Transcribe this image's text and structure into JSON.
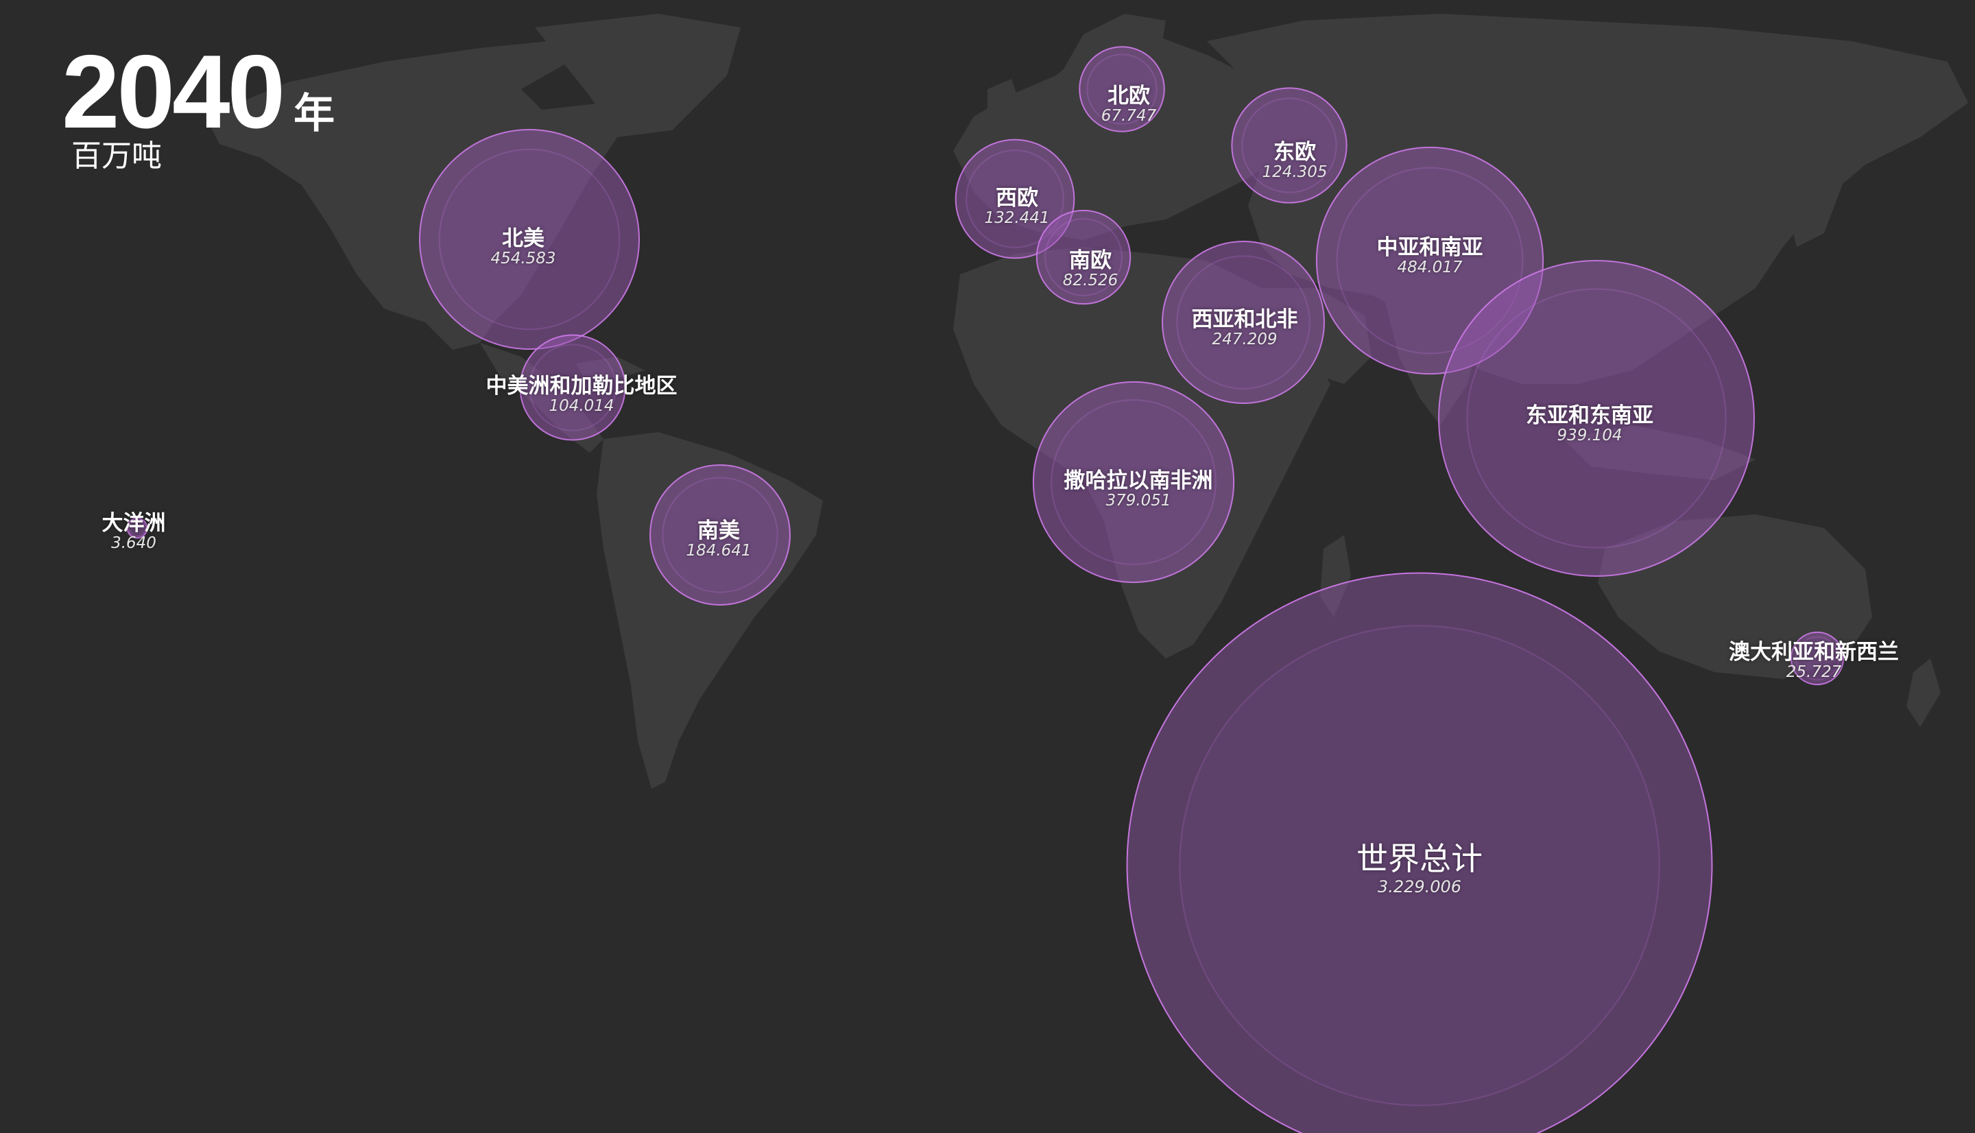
{
  "header": {
    "year": "2040",
    "year_suffix": "年",
    "unit": "百万吨"
  },
  "colors": {
    "background": "#2b2b2b",
    "land": "#3c3c3c",
    "bubble_fill": "#9a5ab4",
    "bubble_stroke": "#d47cf0",
    "text": "#ffffff"
  },
  "regions": [
    {
      "id": "north-america",
      "name": "北美",
      "value": "454.583"
    },
    {
      "id": "central-america-caribbean",
      "name": "中美洲和加勒比地区",
      "value": "104.014"
    },
    {
      "id": "south-america",
      "name": "南美",
      "value": "184.641"
    },
    {
      "id": "oceania",
      "name": "大洋洲",
      "value": "3.640"
    },
    {
      "id": "northern-europe",
      "name": "北欧",
      "value": "67.747"
    },
    {
      "id": "western-europe",
      "name": "西欧",
      "value": "132.441"
    },
    {
      "id": "southern-europe",
      "name": "南欧",
      "value": "82.526"
    },
    {
      "id": "eastern-europe",
      "name": "东欧",
      "value": "124.305"
    },
    {
      "id": "west-asia-north-africa",
      "name": "西亚和北非",
      "value": "247.209"
    },
    {
      "id": "central-south-asia",
      "name": "中亚和南亚",
      "value": "484.017"
    },
    {
      "id": "east-southeast-asia",
      "name": "东亚和东南亚",
      "value": "939.104"
    },
    {
      "id": "sub-saharan-africa",
      "name": "撒哈拉以南非洲",
      "value": "379.051"
    },
    {
      "id": "australia-new-zealand",
      "name": "澳大利亚和新西兰",
      "value": "25.727"
    }
  ],
  "world_total": {
    "name": "世界总计",
    "value": "3.229.006"
  }
}
